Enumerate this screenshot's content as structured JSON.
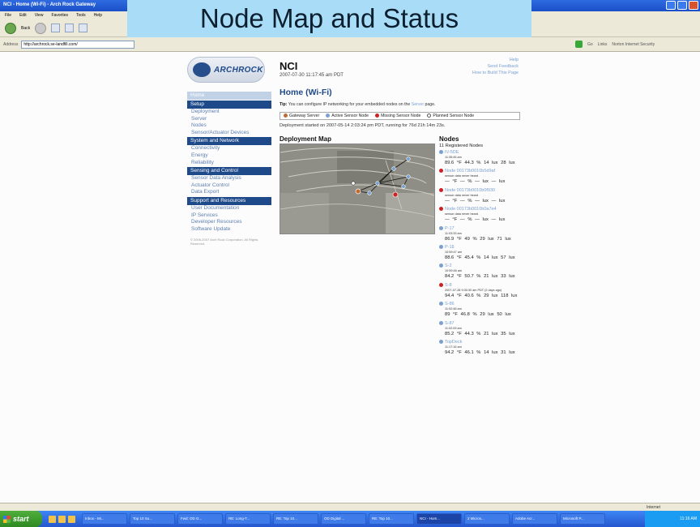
{
  "browser": {
    "window_title": "NCI - Home (Wi-Fi) - Arch Rock Gateway",
    "menu": [
      "File",
      "Edit",
      "View",
      "Favorites",
      "Tools",
      "Help"
    ],
    "back_label": "Back",
    "address_label": "Address",
    "url": "http://archrock.se-landfill.com/",
    "go_label": "Go",
    "links_label": "Links",
    "security_label": "Norton Internet Security"
  },
  "slide_title": "Node Map and Status",
  "page": {
    "logo_text": "ARCHROCK",
    "site_name": "NCI",
    "datetime": "2007-07-30 11:17:45 am PDT",
    "top_links": [
      "Help",
      "Send Feedback",
      "How to Build This Page"
    ],
    "heading": "Home (Wi-Fi)",
    "tip_label": "Tip:",
    "tip_text": "You can configure IP networking for your embedded nodes on the",
    "tip_link": "Server",
    "tip_end": "page.",
    "legend": [
      {
        "label": "Gateway Server",
        "color": "#c06a30"
      },
      {
        "label": "Active Sensor Node",
        "color": "#7aa0cf"
      },
      {
        "label": "Missing Sensor Node",
        "color": "#cc2222"
      },
      {
        "label": "Planned Sensor Node",
        "color": "#ffffff"
      }
    ],
    "deployment_started": "Deployment started on 2007-05-14 2:03:24 pm PDT, running for 76d 21h 14m 23s.",
    "map_title": "Deployment Map",
    "nodes_title": "Nodes",
    "nodes_count": "11 Registered Nodes"
  },
  "nav": {
    "home": "Home",
    "sections": [
      {
        "title": "Setup",
        "items": [
          "Deployment",
          "Server",
          "Nodes",
          "Sensor/Actuator Devices"
        ]
      },
      {
        "title": "System and Network",
        "items": [
          "Connectivity",
          "Energy",
          "Reliability"
        ]
      },
      {
        "title": "Sensing and Control",
        "items": [
          "Sensor Data Analysis",
          "Actuator Control",
          "Data Export"
        ]
      },
      {
        "title": "Support and Resources",
        "items": [
          "User Documentation",
          "IP Services",
          "Developer Resources",
          "Software Update"
        ]
      }
    ],
    "copyright": "© 2006-2007 Arch Rock Corporation. All Rights Reserved."
  },
  "nodes": [
    {
      "name": "IV-5DE",
      "status_color": "#7aa0cf",
      "time": "11:35:45 am",
      "temp": "89.6 °F",
      "humidity": "44.3 %",
      "light1": "14 lux",
      "light2": "28 lux"
    },
    {
      "name": "Node 00173b0010b5d9af",
      "status_color": "#cc2222",
      "time": "sensor data never heard",
      "temp": "— °F",
      "humidity": "— %",
      "light1": "— lux",
      "light2": "— lux"
    },
    {
      "name": "Node 00173b0010b0f930",
      "status_color": "#cc2222",
      "time": "sensor data never heard",
      "temp": "— °F",
      "humidity": "— %",
      "light1": "— lux",
      "light2": "— lux"
    },
    {
      "name": "Node 00173b0010b0a7e4",
      "status_color": "#cc2222",
      "time": "sensor data never heard",
      "temp": "— °F",
      "humidity": "— %",
      "light1": "— lux",
      "light2": "— lux"
    },
    {
      "name": "P-17",
      "status_color": "#7aa0cf",
      "time": "11:03:33 am",
      "temp": "86.9 °F",
      "humidity": "49 %",
      "light1": "29 lux",
      "light2": "71 lux"
    },
    {
      "name": "P-18",
      "status_color": "#7aa0cf",
      "time": "10:59:47 am",
      "temp": "88.6 °F",
      "humidity": "45.4 %",
      "light1": "14 lux",
      "light2": "57 lux"
    },
    {
      "name": "S-2",
      "status_color": "#7aa0cf",
      "time": "10:59:46 am",
      "temp": "84.2 °F",
      "humidity": "50.7 %",
      "light1": "21 lux",
      "light2": "33 lux"
    },
    {
      "name": "S-8",
      "status_color": "#cc2222",
      "time": "2007-07-28 9:30:30 am PDT (2 days ago)",
      "temp": "94.4 °F",
      "humidity": "40.6 %",
      "light1": "29 lux",
      "light2": "118 lux"
    },
    {
      "name": "S-86",
      "status_color": "#7aa0cf",
      "time": "11:02:48 am",
      "temp": "89 °F",
      "humidity": "46.8 %",
      "light1": "29 lux",
      "light2": "50 lux"
    },
    {
      "name": "S-87",
      "status_color": "#7aa0cf",
      "time": "11:02:09 am",
      "temp": "85.2 °F",
      "humidity": "44.3 %",
      "light1": "21 lux",
      "light2": "35 lux"
    },
    {
      "name": "TopDeck",
      "status_color": "#7aa0cf",
      "time": "11:17:16 am",
      "temp": "94.2 °F",
      "humidity": "46.1 %",
      "light1": "14 lux",
      "light2": "31 lux"
    }
  ],
  "statusbar": {
    "zone": "Internet"
  },
  "taskbar": {
    "start_label": "start",
    "tasks": [
      "Inbox - Mi...",
      "Top 10 Su...",
      "Fwd: OD G...",
      "RE: Long-T...",
      "RE: Top 10...",
      "OD Digital ...",
      "RE: Top 10...",
      "NCI - Hom...",
      "2 Micros...",
      "Adobe Acr...",
      "Microsoft P..."
    ],
    "active_task": 7,
    "clock": "11:16 AM"
  }
}
